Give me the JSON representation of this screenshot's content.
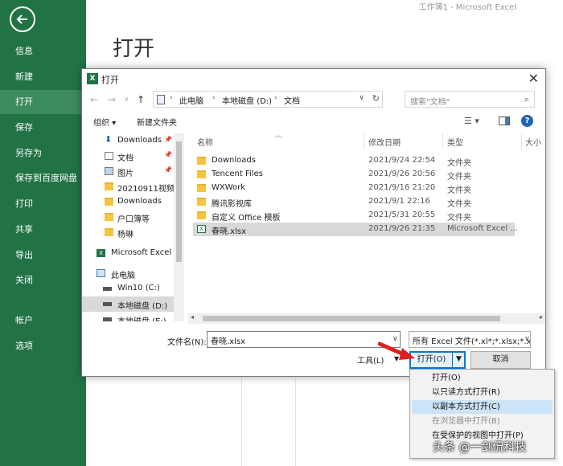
{
  "window_title": "工作簿1 - Microsoft Excel",
  "page_title": "打开",
  "sidebar": {
    "items": [
      {
        "label": "信息"
      },
      {
        "label": "新建"
      },
      {
        "label": "打开"
      },
      {
        "label": "保存"
      },
      {
        "label": "另存为"
      },
      {
        "label": "保存到百度网盘"
      },
      {
        "label": "打印"
      },
      {
        "label": "共享"
      },
      {
        "label": "导出"
      },
      {
        "label": "关闭"
      },
      {
        "label": "帐户"
      },
      {
        "label": "选项"
      }
    ],
    "active": "打开",
    "accent": "#217346"
  },
  "dialog": {
    "title": "打开",
    "icon": "excel-icon",
    "breadcrumb": [
      "此电脑",
      "本地磁盘 (D:)",
      "文档"
    ],
    "search_placeholder": "搜索\"文档\"",
    "toolbar": {
      "organize": "组织 ▾",
      "new_folder": "新建文件夹"
    },
    "tree": [
      {
        "label": "Downloads",
        "icon": "download-icon",
        "pinned": true
      },
      {
        "label": "文档",
        "icon": "document-icon",
        "pinned": true
      },
      {
        "label": "图片",
        "icon": "picture-icon",
        "pinned": true
      },
      {
        "label": "20210911视频",
        "icon": "folder-icon"
      },
      {
        "label": "Downloads",
        "icon": "folder-icon"
      },
      {
        "label": "户口簿等",
        "icon": "folder-icon"
      },
      {
        "label": "杨琳",
        "icon": "folder-icon"
      },
      {
        "label": "Microsoft Excel",
        "icon": "excel-icon"
      },
      {
        "label": "此电脑",
        "icon": "computer-icon"
      },
      {
        "label": "Win10 (C:)",
        "icon": "drive-icon"
      },
      {
        "label": "本地磁盘 (D:)",
        "icon": "drive-icon",
        "selected": true
      },
      {
        "label": "本地磁盘 (E:)",
        "icon": "drive-icon"
      }
    ],
    "columns": {
      "name": "名称",
      "date": "修改日期",
      "type": "类型",
      "size": "大小"
    },
    "files": [
      {
        "name": "Downloads",
        "date": "2021/9/24 22:54",
        "type": "文件夹",
        "icon": "folder-icon"
      },
      {
        "name": "Tencent Files",
        "date": "2021/9/26 20:56",
        "type": "文件夹",
        "icon": "folder-icon"
      },
      {
        "name": "WXWork",
        "date": "2021/9/16 21:20",
        "type": "文件夹",
        "icon": "folder-icon"
      },
      {
        "name": "腾讯影视库",
        "date": "2021/9/1 22:16",
        "type": "文件夹",
        "icon": "folder-icon"
      },
      {
        "name": "自定义 Office 模板",
        "date": "2021/5/31 20:55",
        "type": "文件夹",
        "icon": "folder-icon"
      },
      {
        "name": "春晓.xlsx",
        "date": "2021/9/26 21:35",
        "type": "Microsoft Excel ...",
        "icon": "xlsx-icon",
        "selected": true
      }
    ],
    "filename_label": "文件名(N):",
    "filename_value": "春晓.xlsx",
    "filter_value": "所有 Excel 文件(*.xl*;*.xlsx;*.xl",
    "tools": "工具(L)",
    "open_button": "打开(O)",
    "cancel_button": "取消"
  },
  "open_menu": [
    {
      "label": "打开(O)"
    },
    {
      "label": "以只读方式打开(R)"
    },
    {
      "label": "以副本方式打开(C)",
      "highlighted": true
    },
    {
      "label": "在浏览器中打开(B)",
      "disabled": true
    },
    {
      "label": "在受保护的视图中打开(P)"
    }
  ],
  "watermark": "头条 @一剑侃科技"
}
